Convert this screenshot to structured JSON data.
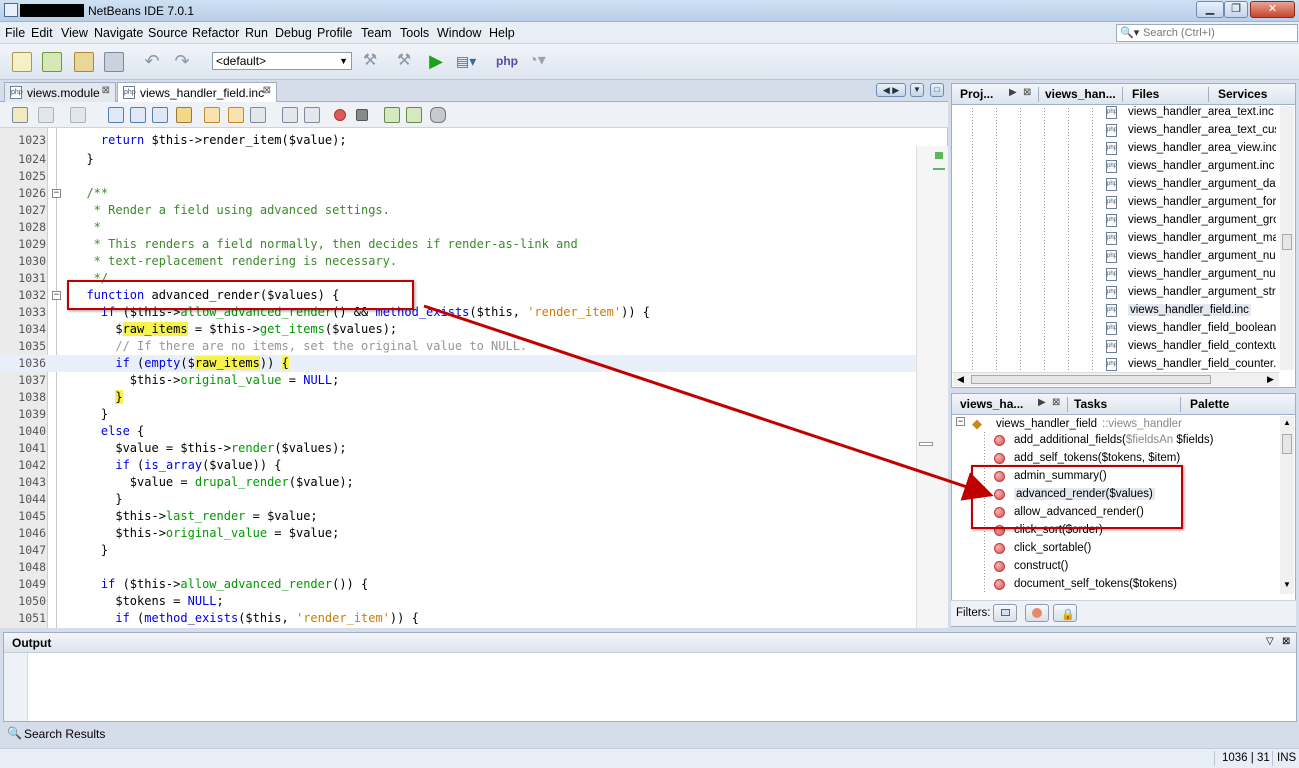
{
  "window": {
    "title": "NetBeans IDE 7.0.1"
  },
  "menu": [
    "File",
    "Edit",
    "View",
    "Navigate",
    "Source",
    "Refactor",
    "Run",
    "Debug",
    "Profile",
    "Team",
    "Tools",
    "Window",
    "Help"
  ],
  "search": {
    "placeholder": "Search (Ctrl+I)"
  },
  "toolbar": {
    "config_value": "<default>"
  },
  "editor_tabs": [
    {
      "label": "views.module"
    },
    {
      "label": "views_handler_field.inc"
    }
  ],
  "code_lines": [
    {
      "n": "1023",
      "text": "    return $this->render_item($value);"
    },
    {
      "n": "1024",
      "text": "  }"
    },
    {
      "n": "1025",
      "text": ""
    },
    {
      "n": "1026",
      "text": "  /**"
    },
    {
      "n": "1027",
      "text": "   * Render a field using advanced settings."
    },
    {
      "n": "1028",
      "text": "   *"
    },
    {
      "n": "1029",
      "text": "   * This renders a field normally, then decides if render-as-link and"
    },
    {
      "n": "1030",
      "text": "   * text-replacement rendering is necessary."
    },
    {
      "n": "1031",
      "text": "   */"
    },
    {
      "n": "1032",
      "text": "  function advanced_render($values) {"
    },
    {
      "n": "1033",
      "text": "    if ($this->allow_advanced_render() && method_exists($this, 'render_item')) {"
    },
    {
      "n": "1034",
      "text": "      $raw_items = $this->get_items($values);"
    },
    {
      "n": "1035",
      "text": "      // If there are no items, set the original value to NULL."
    },
    {
      "n": "1036",
      "text": "      if (empty($raw_items)) {"
    },
    {
      "n": "1037",
      "text": "        $this->original_value = NULL;"
    },
    {
      "n": "1038",
      "text": "      }"
    },
    {
      "n": "1039",
      "text": "    }"
    },
    {
      "n": "1040",
      "text": "    else {"
    },
    {
      "n": "1041",
      "text": "      $value = $this->render($values);"
    },
    {
      "n": "1042",
      "text": "      if (is_array($value)) {"
    },
    {
      "n": "1043",
      "text": "        $value = drupal_render($value);"
    },
    {
      "n": "1044",
      "text": "      }"
    },
    {
      "n": "1045",
      "text": "      $this->last_render = $value;"
    },
    {
      "n": "1046",
      "text": "      $this->original_value = $value;"
    },
    {
      "n": "1047",
      "text": "    }"
    },
    {
      "n": "1048",
      "text": ""
    },
    {
      "n": "1049",
      "text": "    if ($this->allow_advanced_render()) {"
    },
    {
      "n": "1050",
      "text": "      $tokens = NULL;"
    },
    {
      "n": "1051",
      "text": "      if (method_exists($this, 'render_item')) {"
    }
  ],
  "projects_panel": {
    "tabs": [
      "Proj...",
      "views_han...",
      "Files",
      "Services"
    ],
    "files": [
      "views_handler_area_text.inc",
      "views_handler_area_text_custom.inc",
      "views_handler_area_view.inc",
      "views_handler_argument.inc",
      "views_handler_argument_date.inc",
      "views_handler_argument_formula.inc",
      "views_handler_argument_group_by_numeric.inc",
      "views_handler_argument_many_to_one.inc",
      "views_handler_argument_null.inc",
      "views_handler_argument_numeric.inc",
      "views_handler_argument_string.inc",
      "views_handler_field.inc",
      "views_handler_field_boolean.inc",
      "views_handler_field_contextual_links.inc",
      "views_handler_field_counter.inc"
    ],
    "selected": "views_handler_field.inc"
  },
  "navigator_panel": {
    "tabs": [
      "views_ha...",
      "Tasks",
      "Palette"
    ],
    "root": "views_handler_field",
    "root_parent": "::views_handler",
    "members": [
      {
        "label": "add_additional_fields(",
        "extra": "$fieldsAn",
        "tail": " $fields)"
      },
      {
        "label": "add_self_tokens($tokens, $item)"
      },
      {
        "label": "admin_summary()"
      },
      {
        "label": "advanced_render($values)"
      },
      {
        "label": "allow_advanced_render()"
      },
      {
        "label": "click_sort($order)"
      },
      {
        "label": "click_sortable()"
      },
      {
        "label": "construct()"
      },
      {
        "label": "document_self_tokens($tokens)"
      }
    ],
    "filters_label": "Filters:"
  },
  "output": {
    "title": "Output"
  },
  "search_results": {
    "label": "Search Results"
  },
  "status": {
    "position": "1036 | 31",
    "mode": "INS"
  },
  "colors": {
    "annotation": "#c00000",
    "keyword": "#0000e6",
    "highlight": "#f6f34a"
  }
}
